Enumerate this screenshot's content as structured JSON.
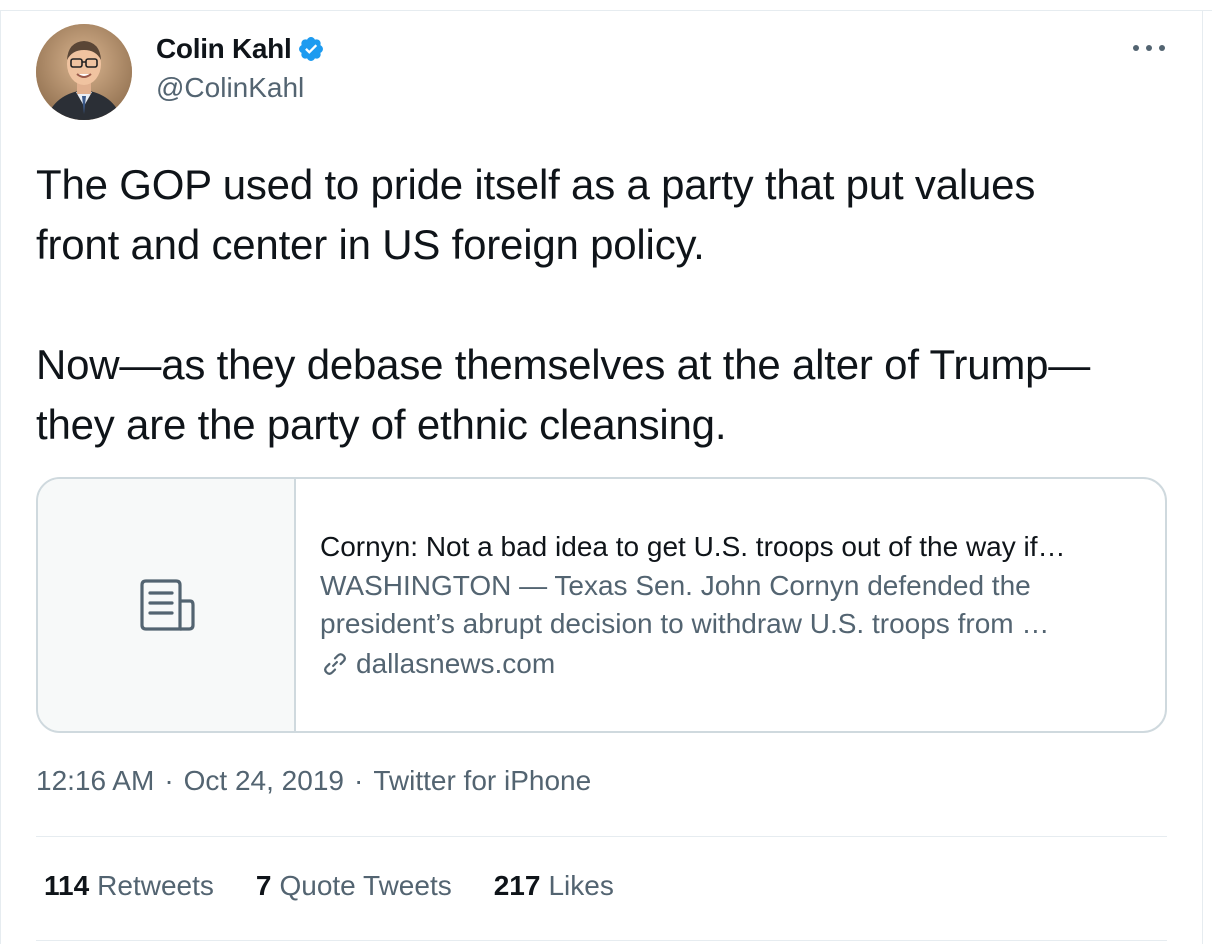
{
  "author": {
    "name": "Colin Kahl",
    "handle": "@ColinKahl",
    "verified": true,
    "avatar_icon": "profile-photo"
  },
  "tweet": {
    "paragraphs": [
      [
        "The GOP used to pride itself as a party that put values",
        "front and center in US foreign policy."
      ],
      [
        "Now—as they debase themselves at the alter of Trump—",
        "they are the party of ethnic cleansing."
      ]
    ]
  },
  "card": {
    "thumb_icon": "article-icon",
    "title": "Cornyn: Not a bad idea to get U.S. troops out of the way if…",
    "description_lines": [
      "WASHINGTON — Texas Sen. John Cornyn defended the",
      "president’s abrupt decision to withdraw U.S. troops from …"
    ],
    "domain": "dallasnews.com",
    "domain_icon": "link-icon"
  },
  "meta": {
    "time": "12:16 AM",
    "date": "Oct 24, 2019",
    "source": "Twitter for iPhone",
    "separator": "·"
  },
  "stats": {
    "retweets": {
      "count": "114",
      "label": "Retweets"
    },
    "quotes": {
      "count": "7",
      "label": "Quote Tweets"
    },
    "likes": {
      "count": "217",
      "label": "Likes"
    }
  },
  "colors": {
    "verified": "#1d9bf0",
    "secondary_text": "#536471",
    "primary_text": "#0f1419",
    "border": "#cfd9de"
  },
  "more_icon": "more-options-icon"
}
